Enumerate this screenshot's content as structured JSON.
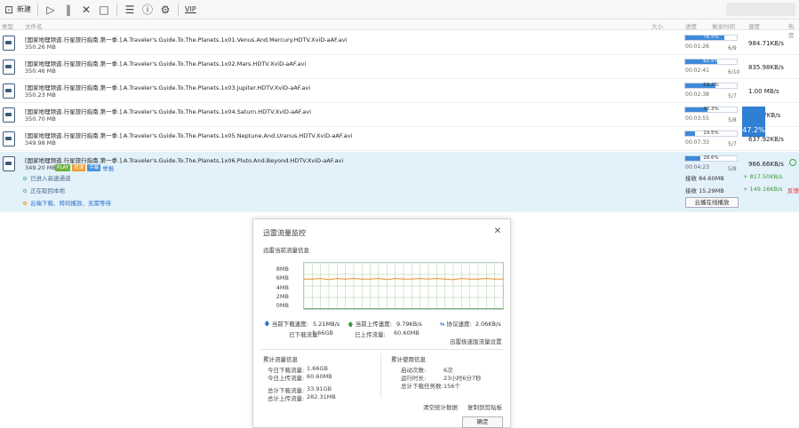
{
  "toolbar": {
    "new_label": "新建",
    "vip_label": "VIP",
    "icons": [
      "new-icon",
      "play-icon",
      "pause-icon",
      "delete-icon",
      "open-folder-icon",
      "sort-icon",
      "info-icon",
      "settings-icon",
      "vip-icon"
    ]
  },
  "columns": {
    "type": "类型",
    "filename": "文件名",
    "size": "大小",
    "progress": "进度",
    "remaining": "剩余时间",
    "speed": "速度",
    "hot": "热度"
  },
  "downloads": [
    {
      "name": "[国家地理频道.行星旅行指南.第一季.].A.Traveler's.Guide.To.The.Planets.1x01.Venus.And.Mercury.HDTV.XviD-aAF.avi",
      "size": "350.26 MB",
      "progress_pct": 76.5,
      "progress_label": "76.5%",
      "time": "00:01:26",
      "count": "6/9",
      "speed": "984.71KB/s"
    },
    {
      "name": "[国家地理频道.行星旅行指南.第一季.].A.Traveler's.Guide.To.The.Planets.1x02.Mars.HDTV.XviD-aAF.avi",
      "size": "350.46 MB",
      "progress_pct": 62.5,
      "progress_label": "62.5%",
      "time": "00:02:41",
      "count": "6/10",
      "speed": "835.98KB/s"
    },
    {
      "name": "[国家地理频道.行星旅行指南.第一季.].A.Traveler's.Guide.To.The.Planets.1x03.Jupiter.HDTV.XviD-aAF.avi",
      "size": "350.23 MB",
      "progress_pct": 59.2,
      "progress_label": "59.2%",
      "time": "00:02:38",
      "count": "5/7",
      "speed": "1.00   MB/s"
    },
    {
      "name": "[国家地理频道.行星旅行指南.第一季.].A.Traveler's.Guide.To.The.Planets.1x04.Saturn.HDTV.XviD-aAF.avi",
      "size": "350.70 MB",
      "progress_pct": 42.3,
      "progress_label": "42.3%",
      "time": "00:03:55",
      "count": "5/8",
      "speed": "???.??KB/s"
    },
    {
      "name": "[国家地理频道.行星旅行指南.第一季.].A.Traveler's.Guide.To.The.Planets.1x05.Neptune.And.Uranus.HDTV.XviD-aAF.avi",
      "size": "349.98 MB",
      "progress_pct": 19.5,
      "progress_label": "19.5%",
      "time": "00:07:33",
      "count": "5/7",
      "speed": "637.92KB/s"
    },
    {
      "name": "[国家地理频道.行星旅行指南.第一季.].A.Traveler's.Guide.To.The.Planets.1x06.Pluto.And.Beyond.HDTV.XviD-aAF.avi",
      "size": "349.20 MB",
      "progress_pct": 28.6,
      "progress_label": "28.6%",
      "time": "00:04:23",
      "count": "5/8",
      "speed": "966.66KB/s"
    }
  ],
  "selected": {
    "tag_play": "PLAY",
    "tag_vip": "提速",
    "tag_sub": "字幕",
    "tag_report": "举报",
    "status1": "已进入高速通道",
    "status2": "正在取回本地",
    "status3": "云端下载、转码播放、无需等待",
    "recv1": "接收 84.60MB",
    "recv1_speed": "+ 817.50KB/s",
    "recv2": "接收 15.29MB",
    "recv2_speed": "+ 149.16KB/s",
    "feedback": "反馈",
    "cloud_play": "云播在线播放"
  },
  "popup": {
    "label": "47.2%"
  },
  "monitor": {
    "title": "迅雷流量监控",
    "current_section": "迅雷当前流量信息",
    "y_labels": [
      "8MB",
      "6MB",
      "4MB",
      "2MB",
      "0MB"
    ],
    "download_speed_label": "当前下载速度:",
    "download_speed": "5.21MB/s",
    "upload_speed_label": "当前上传速度:",
    "upload_speed": "9.79KB/s",
    "protocol_label": "协议速度:",
    "protocol_speed": "2.06KB/s",
    "downloaded_label": "已下载流量:",
    "downloaded": "1.66GB",
    "uploaded_label": "已上传流量:",
    "uploaded": "60.60MB",
    "settings_link": "迅雷极速版流量设置",
    "cumulative_title": "累计流量信息",
    "today_down_label": "今日下载流量:",
    "today_down": "1.66GB",
    "today_up_label": "今日上传流量:",
    "today_up": "60.60MB",
    "total_down_label": "总计下载流量:",
    "total_down": "33.91GB",
    "total_up_label": "总计上传流量:",
    "total_up": "282.31MB",
    "usage_title": "累计使用信息",
    "launches_label": "启动次数:",
    "launches": "6次",
    "runtime_label": "运行时长:",
    "runtime": "23小时6分7秒",
    "tasks_label": "总计下载任务数:",
    "tasks": "156个",
    "clear_link": "清空统计数据",
    "copy_link": "复制到剪贴板",
    "ok": "确定"
  },
  "chart_data": {
    "type": "line",
    "ylim": [
      0,
      8
    ],
    "series": [
      {
        "values": [
          5.2,
          5.2,
          5.3,
          5.1,
          5.3,
          5.2,
          5.3,
          5.2,
          5.2,
          5.3,
          5.1,
          5.3,
          5.2,
          5.2,
          5.3,
          5.2,
          5.3,
          5.2,
          5.1,
          5.3,
          5.2,
          5.2,
          5.3,
          5.2,
          5.2
        ],
        "color": "#f0892b"
      },
      {
        "values": [
          0.03,
          0.03,
          0.03,
          0.03,
          0.03,
          0.03,
          0.03,
          0.03,
          0.03,
          0.03,
          0.03,
          0.03,
          0.03,
          0.03,
          0.03,
          0.03,
          0.03,
          0.03,
          0.03,
          0.03,
          0.03,
          0.03,
          0.03,
          0.03,
          0.03
        ],
        "color": "#5aa03c"
      }
    ]
  }
}
